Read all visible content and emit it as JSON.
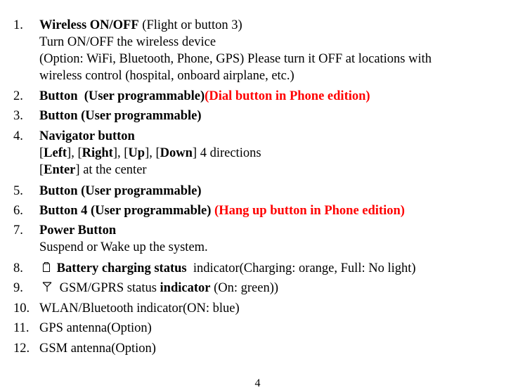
{
  "items": [
    {
      "number": "1.",
      "title": "Wireless ON/OFF",
      "title_suffix": " (Flight or button 3)",
      "lines": [
        "Turn ON/OFF the wireless device",
        "(Option: WiFi, Bluetooth, Phone, GPS) Please turn it OFF at locations with",
        "wireless control (hospital, onboard airplane, etc.)"
      ]
    },
    {
      "number": "2.",
      "title": "Button  (User programmable)",
      "note": "(Dial button in Phone edition)"
    },
    {
      "number": "3.",
      "title": "Button (User programmable)"
    },
    {
      "number": "4.",
      "title": "Navigator button",
      "directions": {
        "left": "Left",
        "right": "Right",
        "up": "Up",
        "down": "Down",
        "suffix": " 4 directions"
      },
      "enter": {
        "key": "Enter",
        "suffix": " at the center"
      }
    },
    {
      "number": "5.",
      "title": "Button (User programmable)"
    },
    {
      "number": "6.",
      "title": "Button 4 (User programmable)",
      "note": "(Hang up button in Phone edition)"
    },
    {
      "number": "7.",
      "title": "Power Button",
      "lines": [
        "Suspend or Wake up the system."
      ]
    },
    {
      "number": "8.",
      "icon": "battery-icon",
      "title": "Battery charging status",
      "text": "indicator(Charging: orange, Full: No light)"
    },
    {
      "number": "9.",
      "icon": "antenna-icon",
      "text_pre": "GSM/GPRS status ",
      "bold": "indicator",
      "text_post": " (On: green))"
    },
    {
      "number": "10.",
      "text": "WLAN/Bluetooth indicator(ON: blue)"
    },
    {
      "number": "11.",
      "text": "GPS antenna(Option)"
    },
    {
      "number": "12.",
      "text": "GSM antenna(Option)"
    }
  ],
  "footer": {
    "page_number": "4"
  },
  "colors": {
    "text": "#000000",
    "highlight_red": "#ff0000"
  }
}
